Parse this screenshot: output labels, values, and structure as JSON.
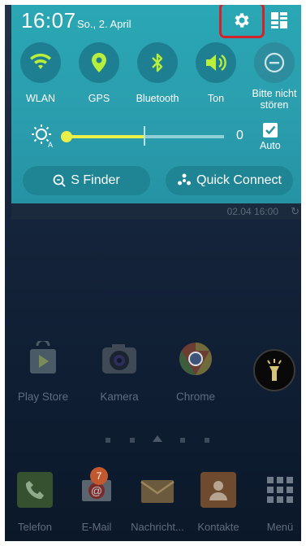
{
  "status": {
    "time": "16:07",
    "date": "So., 2. April"
  },
  "quick_toggles": [
    {
      "label": "WLAN",
      "icon": "wifi-icon",
      "active": true
    },
    {
      "label": "GPS",
      "icon": "location-pin-icon",
      "active": true
    },
    {
      "label": "Bluetooth",
      "icon": "bluetooth-icon",
      "active": true
    },
    {
      "label": "Ton",
      "icon": "volume-icon",
      "active": true
    },
    {
      "label": "Bitte nicht stören",
      "icon": "do-not-disturb-icon",
      "active": false
    }
  ],
  "brightness": {
    "value": "0",
    "auto_label": "Auto",
    "auto_checked": true,
    "level": 0
  },
  "buttons": {
    "s_finder": "S Finder",
    "quick_connect": "Quick Connect"
  },
  "notification_strip": {
    "timestamp": "02.04 16:00"
  },
  "apps": [
    {
      "label": "Play Store",
      "icon": "play-store-icon"
    },
    {
      "label": "Kamera",
      "icon": "camera-icon"
    },
    {
      "label": "Chrome",
      "icon": "chrome-icon"
    }
  ],
  "torch": {
    "icon": "flashlight-icon"
  },
  "dock": [
    {
      "label": "Telefon",
      "icon": "phone-icon"
    },
    {
      "label": "E-Mail",
      "icon": "email-icon",
      "badge": "7"
    },
    {
      "label": "Nachricht...",
      "icon": "message-icon"
    },
    {
      "label": "Kontakte",
      "icon": "contacts-icon"
    },
    {
      "label": "Menü",
      "icon": "apps-grid-icon"
    }
  ],
  "colors": {
    "panel": "#2aa7b4",
    "highlight": "#d3222a",
    "slider_fill": "#e9f04a"
  }
}
